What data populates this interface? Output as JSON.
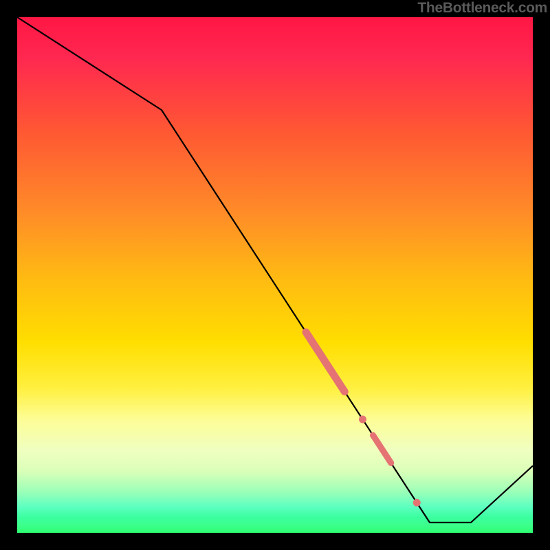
{
  "watermark": "TheBottleneck.com",
  "chart_data": {
    "type": "line",
    "title": "",
    "xlabel": "",
    "ylabel": "",
    "x": [
      0,
      0.28,
      0.8,
      0.88,
      1.0
    ],
    "y": [
      1.0,
      0.82,
      0.02,
      0.02,
      0.13
    ],
    "xlim": [
      0,
      1
    ],
    "ylim": [
      0,
      1
    ],
    "markers": [
      {
        "x_start": 0.56,
        "x_end": 0.635,
        "thickness": "thick"
      },
      {
        "x_start": 0.665,
        "x_end": 0.675,
        "thickness": "dot"
      },
      {
        "x_start": 0.69,
        "x_end": 0.725,
        "thickness": "medium"
      },
      {
        "x_start": 0.77,
        "x_end": 0.78,
        "thickness": "dot"
      }
    ],
    "note": "No numeric axis labels are shown in the image; x and y are normalized to the plot area."
  },
  "colors": {
    "line": "#000000",
    "marker": "#e57373",
    "bg_top": "#ff1744",
    "bg_bottom": "#2dff72",
    "frame": "#000000"
  }
}
